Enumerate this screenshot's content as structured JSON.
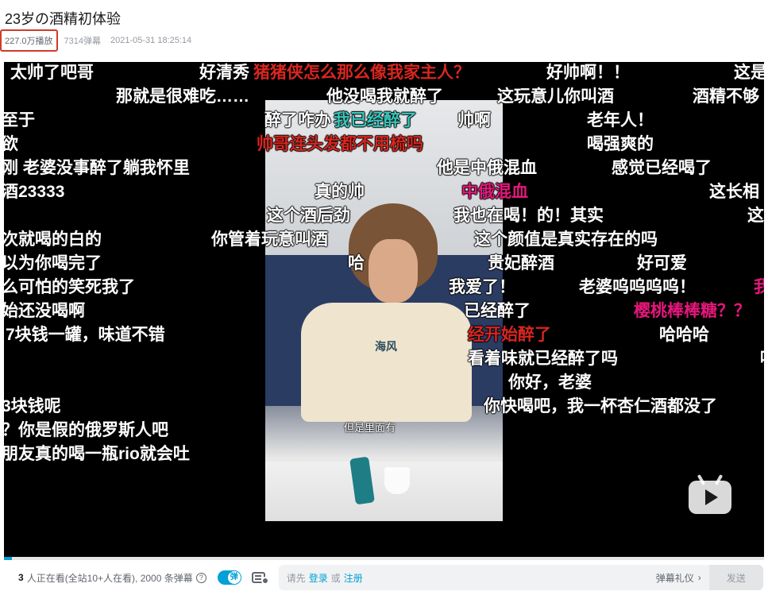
{
  "video": {
    "title": "23岁の酒精初体验",
    "views": "227.0万播放",
    "danmaku_count": "7314弹幕",
    "date": "2021-05-31 18:25:14",
    "subtitle": "但是里面有",
    "shirt_print": "海风"
  },
  "danmaku": [
    {
      "text": "太帅了吧哥",
      "color": "#ffffff"
    },
    {
      "text": "好清秀",
      "color": "#ffffff"
    },
    {
      "text": "猪猪侠怎么那么像我家主人？",
      "color": "#d8261f"
    },
    {
      "text": "好帅啊！！",
      "color": "#ffffff"
    },
    {
      "text": "这是",
      "color": "#ffffff"
    },
    {
      "text": "!",
      "color": "#ffffff"
    },
    {
      "text": "那就是很难吃……",
      "color": "#ffffff"
    },
    {
      "text": "他没喝我就醉了",
      "color": "#ffffff"
    },
    {
      "text": "这玩意儿你叫酒",
      "color": "#ffffff"
    },
    {
      "text": "酒精不够",
      "color": "#ffffff"
    },
    {
      "text": "至于",
      "color": "#ffffff"
    },
    {
      "text": "醉了咋办",
      "color": "#ffffff"
    },
    {
      "text": "我已经醉了",
      "color": "#39c5bb"
    },
    {
      "text": "帅啊",
      "color": "#ffffff"
    },
    {
      "text": "老年人！",
      "color": "#ffffff"
    },
    {
      "text": "帅哥连头发都不用梳吗",
      "color": "#d8261f"
    },
    {
      "text": "欲",
      "color": "#ffffff"
    },
    {
      "text": "喝强爽的",
      "color": "#ffffff"
    },
    {
      "text": "刚 老婆没事醉了躺我怀里",
      "color": "#ffffff"
    },
    {
      "text": "他是中俄混血",
      "color": "#ffffff"
    },
    {
      "text": "感觉已经喝了",
      "color": "#ffffff"
    },
    {
      "text": "酒23333",
      "color": "#ffffff"
    },
    {
      "text": "真的帅",
      "color": "#ffffff"
    },
    {
      "text": "中俄混血",
      "color": "#e5177b"
    },
    {
      "text": "这长相",
      "color": "#ffffff"
    },
    {
      "text": "这个酒后劲",
      "color": "#ffffff"
    },
    {
      "text": "我也在喝！的！其实",
      "color": "#ffffff"
    },
    {
      "text": "这",
      "color": "#ffffff"
    },
    {
      "text": "次就喝的白的",
      "color": "#ffffff"
    },
    {
      "text": "你管着玩意叫酒",
      "color": "#ffffff"
    },
    {
      "text": "这个颜值是真实存在的吗",
      "color": "#ffffff"
    },
    {
      "text": "以为你喝完了",
      "color": "#ffffff"
    },
    {
      "text": "哈",
      "color": "#ffffff"
    },
    {
      "text": "贵妃醉酒",
      "color": "#ffffff"
    },
    {
      "text": "好可爱",
      "color": "#ffffff"
    },
    {
      "text": "么可怕的笑死我了",
      "color": "#ffffff"
    },
    {
      "text": "我爱了！",
      "color": "#ffffff"
    },
    {
      "text": "老婆呜呜呜呜！",
      "color": "#ffffff"
    },
    {
      "text": "我",
      "color": "#e5177b"
    },
    {
      "text": "始还没喝啊",
      "color": "#ffffff"
    },
    {
      "text": "已经醉了",
      "color": "#ffffff"
    },
    {
      "text": "樱桃棒棒糖？？",
      "color": "#e5177b"
    },
    {
      "text": "7块钱一罐，味道不错",
      "color": "#ffffff"
    },
    {
      "text": "经开始醉了",
      "color": "#d8261f"
    },
    {
      "text": "哈哈哈",
      "color": "#ffffff"
    },
    {
      "text": "看着味就已经醉了吗",
      "color": "#ffffff"
    },
    {
      "text": "你好，老婆",
      "color": "#ffffff"
    },
    {
      "text": "3块钱呢",
      "color": "#ffffff"
    },
    {
      "text": "你快喝吧，我一杯杏仁酒都没了",
      "color": "#ffffff"
    },
    {
      "text": "？你是假的俄罗斯人吧",
      "color": "#ffffff"
    },
    {
      "text": "朋友真的喝一瓶rio就会吐",
      "color": "#ffffff"
    },
    {
      "text": "哇",
      "color": "#ffffff"
    }
  ],
  "progress": 0.01,
  "bottom_bar": {
    "online_count": "3",
    "online_text": "人正在看(全站10+人在看), 2000 条弹幕",
    "help_icon": "?",
    "toggle_label": "弹",
    "input_prefix": "请先",
    "login_link": "登录",
    "or_text": "或",
    "register_link": "注册",
    "etiquette": "弹幕礼仪",
    "send_button": "发送"
  }
}
